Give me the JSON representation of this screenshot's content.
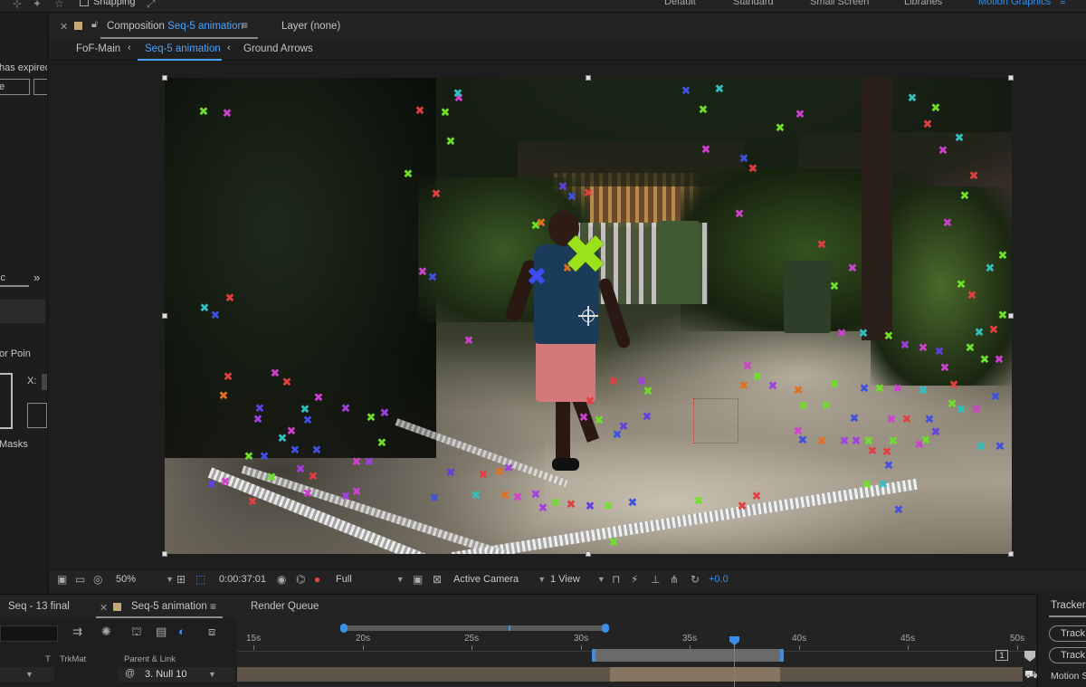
{
  "topbar": {
    "snapping_label": "Snapping",
    "workspaces": [
      "Default",
      "Standard",
      "Small Screen",
      "Libraries",
      "Motion Graphics"
    ],
    "active_workspace": "Motion Graphics"
  },
  "left_panel": {
    "expired_text": "has expired",
    "input_fragment": "e",
    "panel_tab_fragment": "ic",
    "expand_icon": "double-chevron-right",
    "section_label": "or Poin",
    "x_label": "X:",
    "masks_label": "Masks"
  },
  "composition": {
    "tab_prefix": "Composition",
    "tab_name": "Seq-5 animation",
    "layer_tab": "Layer (none)",
    "breadcrumbs": [
      "FoF-Main",
      "Seq-5 animation",
      "Ground Arrows"
    ],
    "active_breadcrumb": "Seq-5 animation"
  },
  "viewer_toolbar": {
    "zoom": "50%",
    "timecode": "0:00:37:01",
    "resolution": "Full",
    "camera": "Active Camera",
    "views": "1 View",
    "exposure": "+0.0"
  },
  "timeline": {
    "tabs": [
      "Seq - 13 final",
      "Seq-5 animation",
      "Render Queue"
    ],
    "active_tab": "Seq-5 animation",
    "columns": [
      "T",
      "TrkMat",
      "Parent & Link"
    ],
    "parent_value": "3. Null 10",
    "ruler_labels": [
      "15s",
      "20s",
      "25s",
      "30s",
      "35s",
      "40s",
      "45s",
      "50s"
    ],
    "marker_count": "1"
  },
  "tracker": {
    "title": "Tracker",
    "buttons": [
      "Track",
      "Track"
    ],
    "motion_label": "Motion S"
  },
  "colors": {
    "accent": "#3b8fe6",
    "tab_blue": "#4aa3ff",
    "track_point_big": "#9be21a"
  }
}
